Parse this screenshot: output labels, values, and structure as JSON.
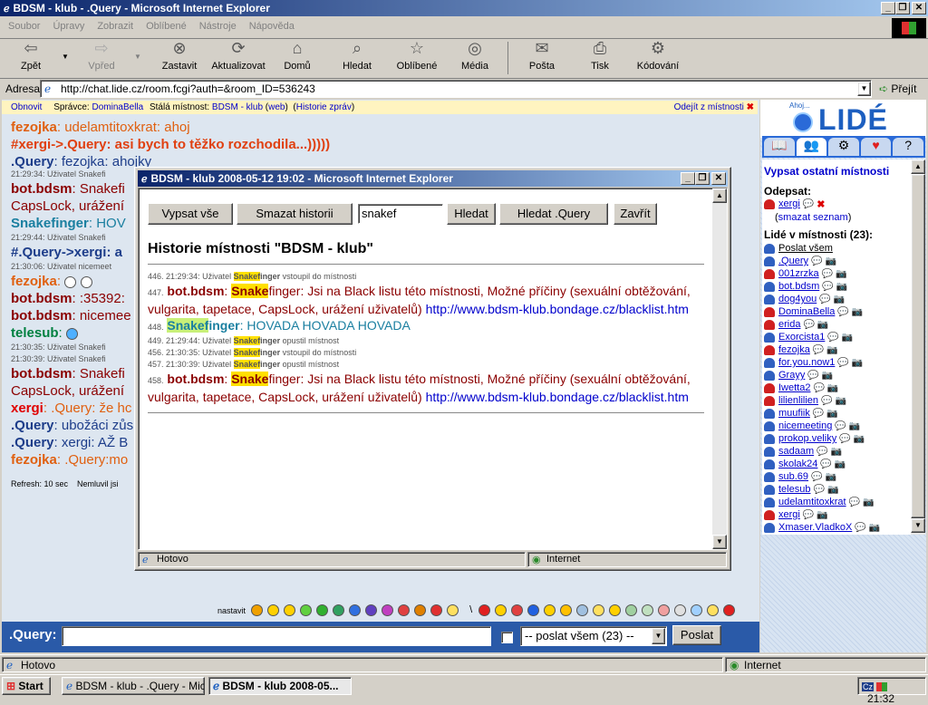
{
  "main_window": {
    "title": "BDSM - klub - .Query - Microsoft Internet Explorer",
    "menu": [
      "Soubor",
      "Úpravy",
      "Zobrazit",
      "Oblíbené",
      "Nástroje",
      "Nápověda"
    ],
    "toolbar": {
      "back": "Zpět",
      "forward": "Vpřed",
      "stop": "Zastavit",
      "refresh": "Aktualizovat",
      "home": "Domů",
      "search": "Hledat",
      "favorites": "Oblíbené",
      "media": "Média",
      "mail": "Pošta",
      "print": "Tisk",
      "encoding": "Kódování"
    },
    "address_label": "Adresa",
    "address_value": "http://chat.lide.cz/room.fcgi?auth=&room_ID=536243",
    "go_label": "Přejít",
    "status": "Hotovo",
    "status_zone": "Internet"
  },
  "room_bar": {
    "refresh": "Obnovit",
    "admin_label": "Správce:",
    "admin": "DominaBella",
    "permanent_label": "Stálá místnost:",
    "room_name": "BDSM - klub",
    "web": "web",
    "history": "Historie zpráv",
    "leave": "Odejít z místnosti"
  },
  "chat": {
    "lines": [
      {
        "nick": "fezojka",
        "sep": ": ",
        "text": "udelamtitoxkrat: ahoj"
      },
      {
        "nick": "#xergi->.Query",
        "sep": ": ",
        "text": "asi bych to těžko rozchodila...)))))"
      },
      {
        "nick": ".Query",
        "sep": ": ",
        "text": "fezojka: ahojky"
      }
    ],
    "side_lines": [
      {
        "kind": "sys",
        "text": "21:29:34: Uživatel Snakefi"
      },
      {
        "nick": "bot.bdsm",
        "text": ": Snakefi"
      },
      {
        "nick": "",
        "text": "CapsLock, urážení"
      },
      {
        "nick": "Snakefinger",
        "text": ": HOV"
      },
      {
        "kind": "sys",
        "text": "21:29:44: Uživatel Snakefi"
      },
      {
        "nick": "#.Query->xergi",
        "text": ": a"
      },
      {
        "kind": "sys",
        "text": "21:30:06: Uživatel nicemeet"
      },
      {
        "nick": "fezojka",
        "text": ":"
      },
      {
        "nick": "bot.bdsm",
        "text": ": :35392:"
      },
      {
        "nick": "bot.bdsm",
        "text": ": nicemee"
      },
      {
        "nick": "telesub",
        "text": ":"
      },
      {
        "kind": "sys",
        "text": "21:30:35: Uživatel Snakefi"
      },
      {
        "kind": "sys",
        "text": "21:30:39: Uživatel Snakefi"
      },
      {
        "nick": "bot.bdsm",
        "text": ": Snakefi"
      },
      {
        "nick": "",
        "text": "CapsLock, urážení"
      },
      {
        "nick": "xergi",
        "text": ": .Query: že hc"
      },
      {
        "nick": ".Query",
        "text": ": ubožáci zůs"
      },
      {
        "nick": ".Query",
        "text": ": xergi: AŽ B"
      },
      {
        "nick": "fezojka",
        "text": ": .Query:mo"
      }
    ],
    "refresh_info": "Refresh: 10 sec",
    "idle_info": "Nemluvil jsi"
  },
  "composer": {
    "nick": ".Query:",
    "input_value": "",
    "target": "-- poslat všem (23) --",
    "send": "Poslat",
    "emoji_label": "nastavit"
  },
  "sidebar": {
    "brand_greeting": "Ahoj...",
    "brand": "LIDÉ",
    "list_rooms": "Vypsat ostatní místnosti",
    "away_label": "Odepsat:",
    "away_user": "xergi",
    "clear_list": "smazat seznam",
    "people_label": "Lidé v místnosti (23):",
    "send_all": "Poslat všem",
    "users": [
      {
        "name": ".Query",
        "color": "#3060c0"
      },
      {
        "name": "001zrzka",
        "color": "#d02020"
      },
      {
        "name": "bot.bdsm",
        "color": "#3060c0"
      },
      {
        "name": "dog4you",
        "color": "#3060c0"
      },
      {
        "name": "DominaBella",
        "color": "#d02020"
      },
      {
        "name": "erida",
        "color": "#d02020"
      },
      {
        "name": "Exorcista1",
        "color": "#3060c0"
      },
      {
        "name": "fezojka",
        "color": "#d02020"
      },
      {
        "name": "for.you.now1",
        "color": "#3060c0"
      },
      {
        "name": "Grayy",
        "color": "#3060c0"
      },
      {
        "name": "Iwetta2",
        "color": "#d02020"
      },
      {
        "name": "lilienlilien",
        "color": "#d02020"
      },
      {
        "name": "muufiik",
        "color": "#3060c0"
      },
      {
        "name": "nicemeeting",
        "color": "#3060c0"
      },
      {
        "name": "prokop.veliky",
        "color": "#3060c0"
      },
      {
        "name": "sadaam",
        "color": "#3060c0"
      },
      {
        "name": "skolak24",
        "color": "#3060c0"
      },
      {
        "name": "sub.69",
        "color": "#3060c0"
      },
      {
        "name": "telesub",
        "color": "#3060c0"
      },
      {
        "name": "udelamtitoxkrat",
        "color": "#3060c0"
      },
      {
        "name": "xergi",
        "color": "#d02020"
      },
      {
        "name": "Xmaser.VladkoX",
        "color": "#3060c0"
      }
    ]
  },
  "popup": {
    "title": "BDSM - klub 2008-05-12 19:02 - Microsoft Internet Explorer",
    "buttons": {
      "list_all": "Vypsat vše",
      "clear": "Smazat historii",
      "search": "Hledat",
      "search_query": "Hledat .Query",
      "close": "Zavřít"
    },
    "search_value": "snakef",
    "heading": "Historie místnosti \"BDSM - klub\"",
    "entries": [
      {
        "num": "446.",
        "time": "21:29:34:",
        "pre": "Uživatel ",
        "hl": "Snakef",
        "post": "inger",
        "rest": " vstoupil do místnosti"
      },
      {
        "num": "447.",
        "nick": "bot.bdsm",
        "hl": "Snake",
        "post": "finger",
        "text": ": Jsi na Black listu této místnosti, Možné příčiny (sexuální obtěžování, vulgarita, tapetace, CapsLock, urážení uživatelů) ",
        "link": "http://www.bdsm-klub.bondage.cz/blacklist.htm"
      },
      {
        "num": "448.",
        "hl": "Snakef",
        "post": "inger",
        "text": ": HOVADA HOVADA HOVADA"
      },
      {
        "num": "449.",
        "time": "21:29:44:",
        "pre": "Uživatel ",
        "hl": "Snakef",
        "post": "inger",
        "rest": " opustil místnost"
      },
      {
        "num": "456.",
        "time": "21:30:35:",
        "pre": "Uživatel ",
        "hl": "Snakef",
        "post": "inger",
        "rest": " vstoupil do místnosti"
      },
      {
        "num": "457.",
        "time": "21:30:39:",
        "pre": "Uživatel ",
        "hl": "Snakef",
        "post": "inger",
        "rest": " opustil místnost"
      },
      {
        "num": "458.",
        "nick": "bot.bdsm",
        "hl": "Snake",
        "post": "finger",
        "text": ": Jsi na Black listu této místnosti, Možné příčiny (sexuální obtěžování, vulgarita, tapetace, CapsLock, urážení uživatelů) ",
        "link": "http://www.bdsm-klub.bondage.cz/blacklist.htm"
      }
    ],
    "status": "Hotovo",
    "status_zone": "Internet"
  },
  "taskbar": {
    "start": "Start",
    "tasks": [
      "BDSM - klub - .Query - Mic...",
      "BDSM - klub 2008-05..."
    ],
    "lang": "Cz",
    "clock": "21:32"
  },
  "colors": {
    "title_active": "#0a246a",
    "chat_bg": "#dde6f0",
    "sidebar_bg": "#d8e4f2",
    "highlight": "#ffe000",
    "bot": "#8b0000",
    "orange": "#e06010",
    "blue_nick": "#1d3d8a",
    "green": "#008040",
    "teal": "#1a7fa0"
  }
}
